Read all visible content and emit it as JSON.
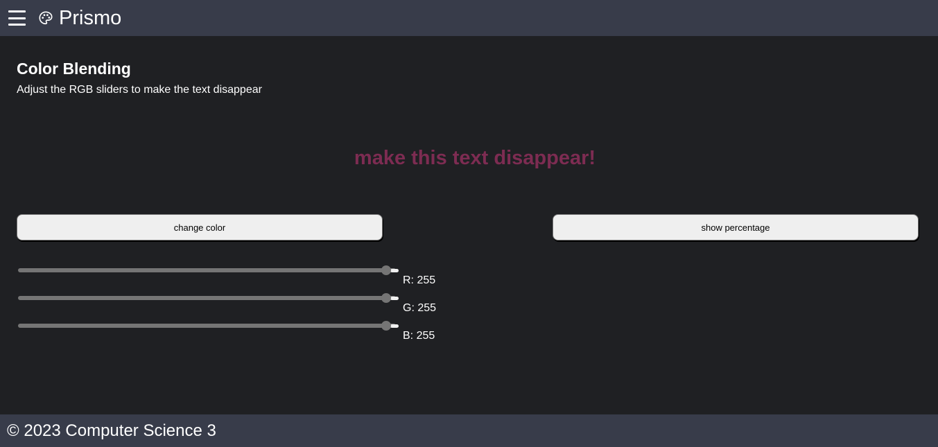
{
  "header": {
    "title": "Prismo",
    "menu_icon": "hamburger-menu-icon",
    "logo_icon": "palette-icon"
  },
  "main": {
    "title": "Color Blending",
    "subtitle": "Adjust the RGB sliders to make the text disappear",
    "target_text": "make this text disappear!",
    "target_text_color": "#7d2c52",
    "buttons": {
      "change_color": "change color",
      "show_percentage": "show percentage"
    },
    "sliders": [
      {
        "label": "R: 255",
        "channel": "R",
        "value": 255,
        "max": 255
      },
      {
        "label": "G: 255",
        "channel": "G",
        "value": 255,
        "max": 255
      },
      {
        "label": "B: 255",
        "channel": "B",
        "value": 255,
        "max": 255
      }
    ]
  },
  "footer": {
    "text": "© 2023 Computer Science 3"
  },
  "colors": {
    "topbar": "#383c4a",
    "background": "#1f2023",
    "button": "#efefef",
    "slider": "#757575"
  }
}
